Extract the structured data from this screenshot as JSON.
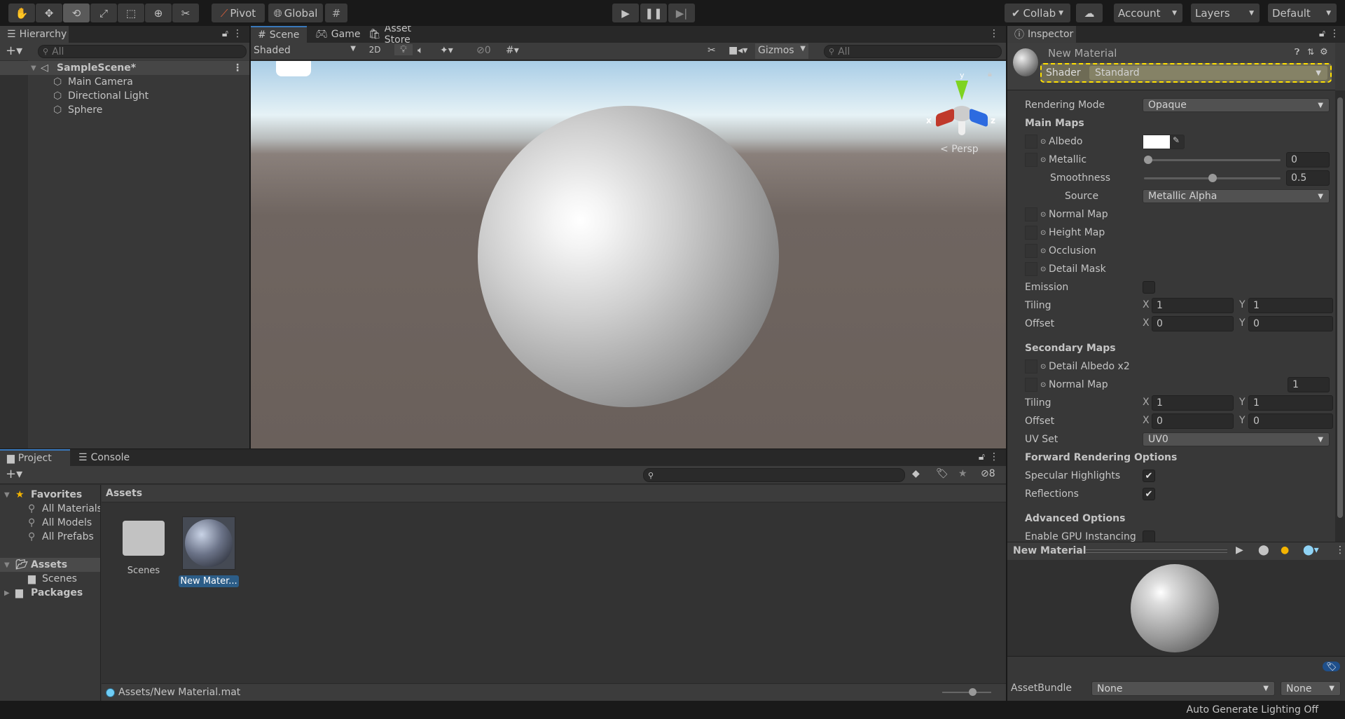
{
  "toolbar": {
    "tools": [
      {
        "name": "hand-tool",
        "glyph": "✋"
      },
      {
        "name": "move-tool",
        "glyph": "✥"
      },
      {
        "name": "rotate-tool",
        "glyph": "⟲"
      },
      {
        "name": "scale-tool",
        "glyph": "⤢"
      },
      {
        "name": "rect-tool",
        "glyph": "⬚"
      },
      {
        "name": "transform-tool",
        "glyph": "⊕"
      },
      {
        "name": "custom-tool",
        "glyph": "✂"
      }
    ],
    "pivot": "Pivot",
    "global": "Global",
    "collab": "Collab",
    "account": "Account",
    "layers": "Layers",
    "layout": "Default"
  },
  "hierarchy": {
    "tab": "Hierarchy",
    "search_placeholder": "All",
    "scene": "SampleScene*",
    "items": [
      "Main Camera",
      "Directional Light",
      "Sphere"
    ]
  },
  "scene": {
    "tabs": [
      "Scene",
      "Game",
      "Asset Store"
    ],
    "shading": "Shaded",
    "mode2d": "2D",
    "hidden_count": "0",
    "gizmos": "Gizmos",
    "search_placeholder": "All",
    "projection": "Persp",
    "axis_x": "x",
    "axis_y": "y",
    "axis_z": "z"
  },
  "inspector": {
    "tab": "Inspector",
    "title": "New Material",
    "shader_label": "Shader",
    "shader": "Standard",
    "rows": [
      {
        "type": "dropdown",
        "label": "Rendering Mode",
        "value": "Opaque"
      },
      {
        "type": "header",
        "label": "Main Maps"
      },
      {
        "type": "color",
        "label": "Albedo",
        "color": "#ffffff"
      },
      {
        "type": "slider",
        "label": "Metallic",
        "value": "0",
        "fraction": 0
      },
      {
        "type": "slider",
        "label": "Smoothness",
        "value": "0.5",
        "fraction": 0.5,
        "indent": 1
      },
      {
        "type": "dropdown",
        "label": "Source",
        "value": "Metallic Alpha",
        "indent": 2
      },
      {
        "type": "texture",
        "label": "Normal Map"
      },
      {
        "type": "texture",
        "label": "Height Map"
      },
      {
        "type": "texture",
        "label": "Occlusion"
      },
      {
        "type": "texture",
        "label": "Detail Mask"
      },
      {
        "type": "checkbox",
        "label": "Emission",
        "checked": false
      },
      {
        "type": "vec2",
        "label": "Tiling",
        "x": "1",
        "y": "1"
      },
      {
        "type": "vec2",
        "label": "Offset",
        "x": "0",
        "y": "0"
      },
      {
        "type": "spacer"
      },
      {
        "type": "header",
        "label": "Secondary Maps"
      },
      {
        "type": "texture",
        "label": "Detail Albedo x2"
      },
      {
        "type": "texture",
        "label": "Normal Map",
        "value": "1"
      },
      {
        "type": "vec2",
        "label": "Tiling",
        "x": "1",
        "y": "1"
      },
      {
        "type": "vec2",
        "label": "Offset",
        "x": "0",
        "y": "0"
      },
      {
        "type": "dropdown",
        "label": "UV Set",
        "value": "UV0"
      },
      {
        "type": "header",
        "label": "Forward Rendering Options"
      },
      {
        "type": "checkbox",
        "label": "Specular Highlights",
        "checked": true
      },
      {
        "type": "checkbox",
        "label": "Reflections",
        "checked": true
      },
      {
        "type": "spacer"
      },
      {
        "type": "header",
        "label": "Advanced Options"
      },
      {
        "type": "checkbox",
        "label": "Enable GPU Instancing",
        "checked": false
      }
    ],
    "preview_title": "New Material",
    "assetbundle_label": "AssetBundle",
    "assetbundle": "None",
    "variant": "None"
  },
  "project": {
    "tabs": [
      "Project",
      "Console"
    ],
    "hidden_count": "8",
    "favorites": "Favorites",
    "favorite_items": [
      "All Materials",
      "All Models",
      "All Prefabs"
    ],
    "assets": "Assets",
    "asset_children": [
      "Scenes"
    ],
    "packages": "Packages",
    "breadcrumb": "Assets",
    "grid": [
      {
        "name": "Scenes",
        "kind": "folder"
      },
      {
        "name": "New Mater...",
        "kind": "material",
        "selected": true
      }
    ],
    "path": "Assets/New Material.mat"
  },
  "status": {
    "text": "Auto Generate Lighting Off"
  },
  "colors": {
    "accent": "#3a79bb",
    "selection": "#2c5d87",
    "highlight": "#ffe000"
  }
}
